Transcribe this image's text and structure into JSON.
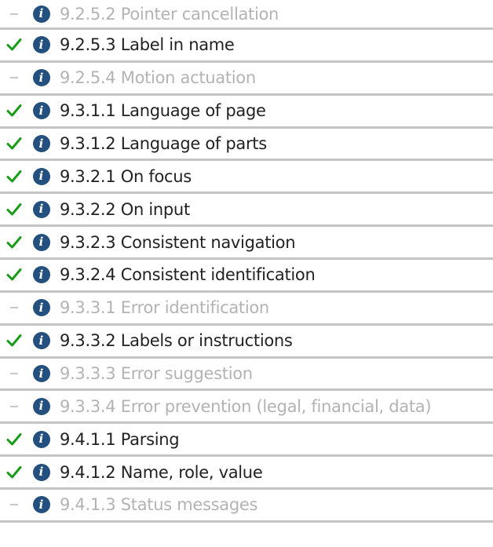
{
  "criteria": [
    {
      "status": "na",
      "label": "9.2.5.2 Pointer cancellation"
    },
    {
      "status": "pass",
      "label": "9.2.5.3 Label in name"
    },
    {
      "status": "na",
      "label": "9.2.5.4 Motion actuation"
    },
    {
      "status": "pass",
      "label": "9.3.1.1 Language of page"
    },
    {
      "status": "pass",
      "label": "9.3.1.2 Language of parts"
    },
    {
      "status": "pass",
      "label": "9.3.2.1 On focus"
    },
    {
      "status": "pass",
      "label": "9.3.2.2 On input"
    },
    {
      "status": "pass",
      "label": "9.3.2.3 Consistent navigation"
    },
    {
      "status": "pass",
      "label": "9.3.2.4 Consistent identification"
    },
    {
      "status": "na",
      "label": "9.3.3.1 Error identification"
    },
    {
      "status": "pass",
      "label": "9.3.3.2 Labels or instructions"
    },
    {
      "status": "na",
      "label": "9.3.3.3 Error suggestion"
    },
    {
      "status": "na",
      "label": "9.3.3.4 Error prevention (legal, financial, data)"
    },
    {
      "status": "pass",
      "label": "9.4.1.1 Parsing"
    },
    {
      "status": "pass",
      "label": "9.4.1.2 Name, role, value"
    },
    {
      "status": "na",
      "label": "9.4.1.3 Status messages"
    }
  ],
  "icons": {
    "pass": "check-icon",
    "na": "dash-icon",
    "info": "info-icon"
  },
  "colors": {
    "check": "#1a9c1a",
    "info": "#23507e",
    "text_pass": "#222222",
    "text_na": "#b3b3b3",
    "divider": "#c4c4c4"
  }
}
